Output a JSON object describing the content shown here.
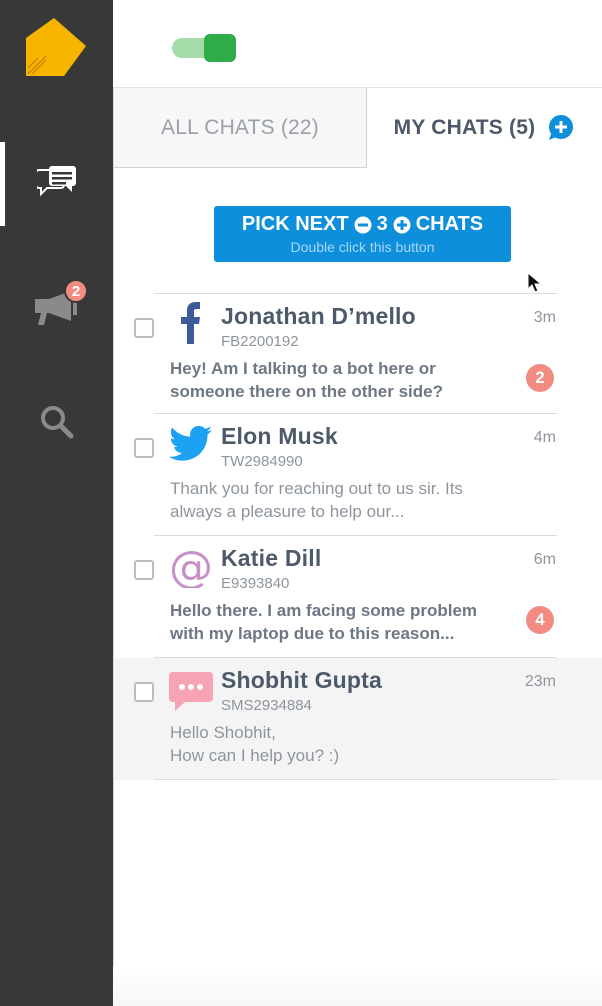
{
  "topbar": {
    "toggle_on": true
  },
  "sidebar": {
    "items": [
      {
        "name": "chats",
        "icon": "chat-bubbles-icon",
        "active": true
      },
      {
        "name": "broadcast",
        "icon": "megaphone-icon",
        "badge": "2"
      },
      {
        "name": "search",
        "icon": "search-icon"
      }
    ]
  },
  "tabs": {
    "all_chats": "ALL CHATS (22)",
    "my_chats": "MY CHATS (5)"
  },
  "pick_button": {
    "label_start": "PICK NEXT",
    "count": "3",
    "label_end": "CHATS",
    "hint": "Double click this button"
  },
  "chats": [
    {
      "name": "Jonathan D’mello",
      "id": "FB2200192",
      "time": "3m",
      "channel": "facebook-icon",
      "message": "Hey! Am I talking to a bot here or someone there on the other side?",
      "unread": "2"
    },
    {
      "name": "Elon Musk",
      "id": "TW2984990",
      "time": "4m",
      "channel": "twitter-icon",
      "message": "Thank you for reaching out to us sir. Its always a pleasure to help our...",
      "unread": ""
    },
    {
      "name": "Katie Dill",
      "id": "E9393840",
      "time": "6m",
      "channel": "email-icon",
      "message": "Hello there. I am facing some problem with my laptop due to this reason...",
      "unread": "4"
    },
    {
      "name": "Shobhit Gupta",
      "id": "SMS2934884",
      "time": "23m",
      "channel": "sms-icon",
      "message_line1": "Hello Shobhit,",
      "message_line2": "How can I help you? :)",
      "unread": ""
    }
  ],
  "colors": {
    "sidebar_bg": "#383838",
    "accent_blue": "#0d8fdc",
    "badge_red": "#f28b82",
    "toggle_green": "#2fab4a",
    "logo_yellow": "#f7b500"
  }
}
